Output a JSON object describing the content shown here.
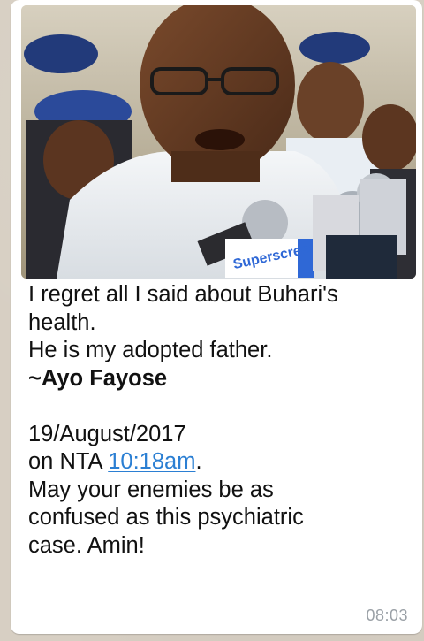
{
  "message": {
    "image": {
      "subject": "man speaking into microphones",
      "microphone_text": "Superscreen"
    },
    "caption": {
      "line1": "I regret all I said about Buhari's",
      "line2": "health.",
      "line3": "He is my adopted father.",
      "line4": "~Ayo Fayose",
      "line6": "19/August/2017",
      "line7_prefix": "on NTA  ",
      "line7_link": "10:18am",
      "line7_suffix": ".",
      "line8": "May your enemies be as",
      "line9": "confused as this psychiatric",
      "line10": "case. Amin!"
    },
    "timestamp": "08:03"
  }
}
